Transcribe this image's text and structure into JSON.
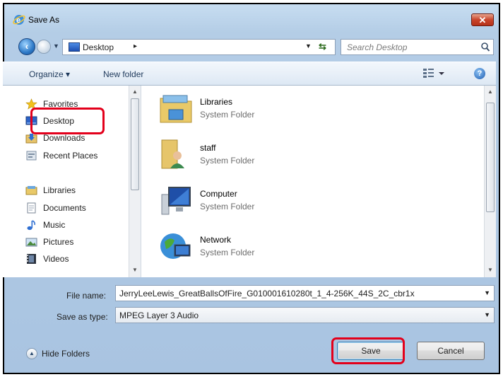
{
  "window": {
    "title": "Save As",
    "close_label": "✕"
  },
  "navigation": {
    "address": {
      "location": "Desktop",
      "separator": "▸"
    },
    "search_placeholder": "Search Desktop"
  },
  "toolbar": {
    "organize": "Organize ▾",
    "new_folder": "New folder",
    "help": "?"
  },
  "sidebar": {
    "items": [
      {
        "label": "Favorites",
        "icon": "star-icon"
      },
      {
        "label": "Desktop",
        "icon": "desktop-icon"
      },
      {
        "label": "Downloads",
        "icon": "downloads-icon"
      },
      {
        "label": "Recent Places",
        "icon": "recent-places-icon"
      },
      {
        "label": "Libraries",
        "icon": "libraries-icon"
      },
      {
        "label": "Documents",
        "icon": "documents-icon"
      },
      {
        "label": "Music",
        "icon": "music-icon"
      },
      {
        "label": "Pictures",
        "icon": "pictures-icon"
      },
      {
        "label": "Videos",
        "icon": "videos-icon"
      }
    ]
  },
  "files": [
    {
      "name": "Libraries",
      "type": "System Folder",
      "icon": "libraries-folder-icon"
    },
    {
      "name": "staff",
      "type": "System Folder",
      "icon": "user-folder-icon"
    },
    {
      "name": "Computer",
      "type": "System Folder",
      "icon": "computer-icon"
    },
    {
      "name": "Network",
      "type": "System Folder",
      "icon": "network-icon"
    }
  ],
  "form": {
    "file_name_label": "File name:",
    "file_name_value": "JerryLeeLewis_GreatBallsOfFire_G010001610280t_1_4-256K_44S_2C_cbr1x",
    "save_type_label": "Save as type:",
    "save_type_value": "MPEG Layer 3 Audio"
  },
  "footer": {
    "hide_folders": "Hide Folders",
    "save": "Save",
    "cancel": "Cancel"
  },
  "colors": {
    "highlight": "#e3001b",
    "title_bar": "#b4cde6",
    "close_button": "#c9452b"
  }
}
